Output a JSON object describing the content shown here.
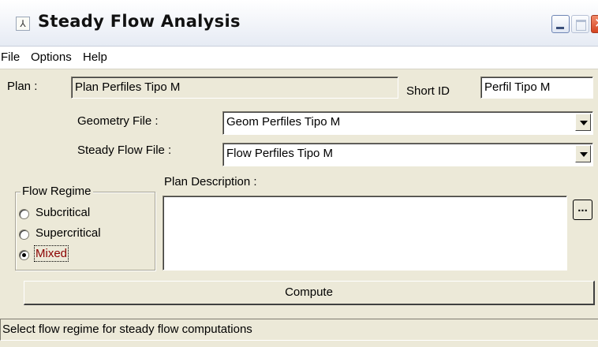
{
  "window": {
    "title": "Steady Flow Analysis",
    "app_icon": "hec-ras-icon",
    "controls": [
      "minimize-icon",
      "maximize-icon",
      "close-icon"
    ]
  },
  "menu": {
    "items": [
      "File",
      "Options",
      "Help"
    ]
  },
  "plan": {
    "label": "Plan :",
    "value": "Plan Perfiles Tipo M",
    "short_id_label": "Short ID",
    "short_id_value": "Perfil Tipo M"
  },
  "geometry": {
    "label": "Geometry File :",
    "value": "Geom Perfiles Tipo M"
  },
  "steady_flow": {
    "label": "Steady Flow File :",
    "value": "Flow Perfiles Tipo M"
  },
  "flow_regime": {
    "legend": "Flow Regime",
    "options": [
      "Subcritical",
      "Supercritical",
      "Mixed"
    ],
    "selected": "Mixed"
  },
  "description": {
    "label": "Plan Description :",
    "value": "",
    "more_button_label": "..."
  },
  "compute_button": "Compute",
  "status": "Select flow regime for steady flow computations",
  "colors": {
    "window_bg": "#ece9d8",
    "selected_label": "#8b0000",
    "close_button": "#d5431f"
  }
}
